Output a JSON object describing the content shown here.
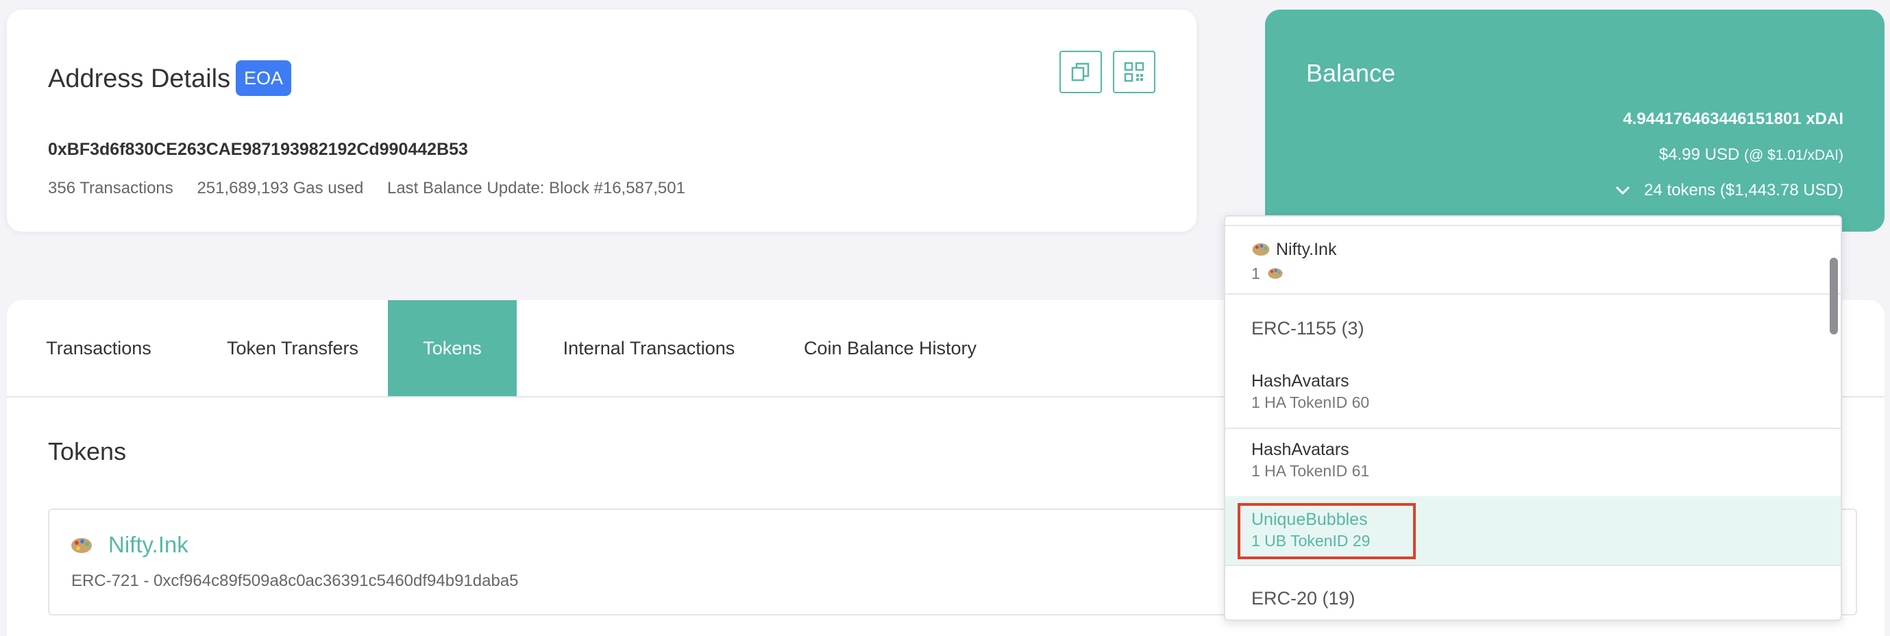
{
  "address": {
    "title": "Address Details",
    "badge": "EOA",
    "hash": "0xBF3d6f830CE263CAE987193982192Cd990442B53",
    "transactions": "356 Transactions",
    "gas_used": "251,689,193 Gas used",
    "last_update": "Last Balance Update: Block #16,587,501"
  },
  "balance": {
    "title": "Balance",
    "xdai": "4.944176463446151801 xDAI",
    "usd": "$4.99 USD",
    "usd_rate": "(@ $1.01/xDAI)",
    "tokens": "24 tokens ($1,443.78 USD)"
  },
  "tabs": [
    {
      "label": "Transactions"
    },
    {
      "label": "Token Transfers"
    },
    {
      "label": "Tokens",
      "active": true
    },
    {
      "label": "Internal Transactions"
    },
    {
      "label": "Coin Balance History"
    }
  ],
  "tokens_section": {
    "heading": "Tokens",
    "row": {
      "name": "Nifty.Ink",
      "meta": "ERC-721 - 0xcf964c89f509a8c0ac36391c5460df94b91daba5"
    }
  },
  "dropdown": {
    "item0": {
      "name": "Nifty.Ink",
      "sub": "1"
    },
    "group1": "ERC-1155 (3)",
    "item1": {
      "name": "HashAvatars",
      "sub": "1 HA TokenID 60"
    },
    "item2": {
      "name": "HashAvatars",
      "sub": "1 HA TokenID 61"
    },
    "item3": {
      "name": "UniqueBubbles",
      "sub": "1 UB TokenID 29"
    },
    "group2": "ERC-20 (19)"
  },
  "colors": {
    "accent": "#56b8a5",
    "badge": "#3d7cf4",
    "highlight_border": "#d9432e"
  },
  "icons": [
    "copy-icon",
    "qr-code-icon",
    "chevron-down-icon",
    "palette-icon"
  ]
}
